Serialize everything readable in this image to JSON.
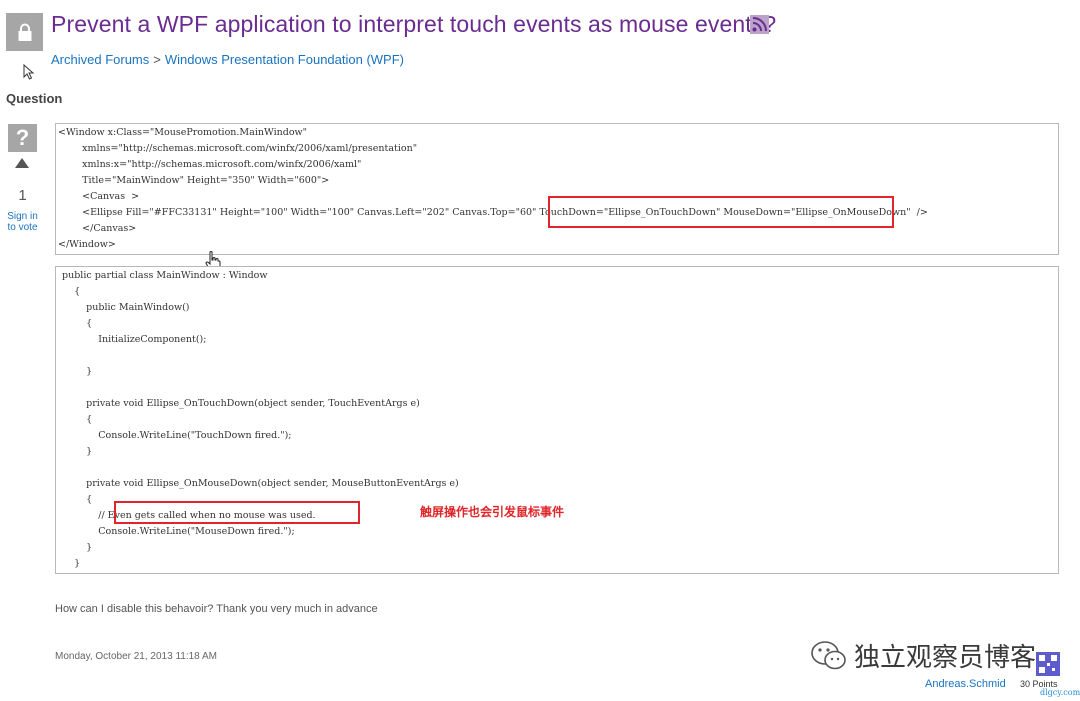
{
  "page": {
    "title": "Prevent a WPF application to interpret touch events as mouse events?",
    "rss_icon": "rss-icon",
    "lock_icon": "lock-icon"
  },
  "breadcrumb": {
    "items": [
      "Archived Forums",
      "Windows Presentation Foundation (WPF)"
    ],
    "separator": ">"
  },
  "question": {
    "label": "Question",
    "vote_symbol": "?",
    "vote_count": "1",
    "sign_in_line1": "Sign in",
    "sign_in_line2": "to vote",
    "body": "How can I disable this behavoir? Thank you very much in advance",
    "date": "Monday, October 21, 2013 11:18 AM",
    "author": "Andreas.Schmid",
    "points": "30 Points"
  },
  "xaml_code": {
    "lines": [
      "<Window x:Class=\"MousePromotion.MainWindow\"",
      "        xmlns=\"http://schemas.microsoft.com/winfx/2006/xaml/presentation\"",
      "        xmlns:x=\"http://schemas.microsoft.com/winfx/2006/xaml\"",
      "        Title=\"MainWindow\" Height=\"350\" Width=\"600\">",
      "        <Canvas  >",
      "        <Ellipse Fill=\"#FFC33131\" Height=\"100\" Width=\"100\" Canvas.Left=\"202\" Canvas.Top=\"60\" TouchDown=\"Ellipse_OnTouchDown\" MouseDown=\"Ellipse_OnMouseDown\"  />",
      "        </Canvas>",
      "</Window>"
    ]
  },
  "cs_code": {
    "lines": [
      "public partial class MainWindow : Window",
      "    {",
      "        public MainWindow()",
      "        {",
      "            InitializeComponent();",
      "",
      "        }",
      "",
      "        private void Ellipse_OnTouchDown(object sender, TouchEventArgs e)",
      "        {",
      "            Console.WriteLine(\"TouchDown fired.\");",
      "        }",
      "",
      "        private void Ellipse_OnMouseDown(object sender, MouseButtonEventArgs e)",
      "        {",
      "            // Even gets called when no mouse was used.",
      "            Console.WriteLine(\"MouseDown fired.\");",
      "        }",
      "    }"
    ]
  },
  "annotation": {
    "text": "触屏操作也会引发鼠标事件",
    "color": "#e0262a"
  },
  "watermark": {
    "text": "独立观察员博客",
    "site": "dlgcy.com"
  },
  "colors": {
    "title": "#6b2c91",
    "link": "#1a73c0",
    "highlight": "#e0262a"
  }
}
